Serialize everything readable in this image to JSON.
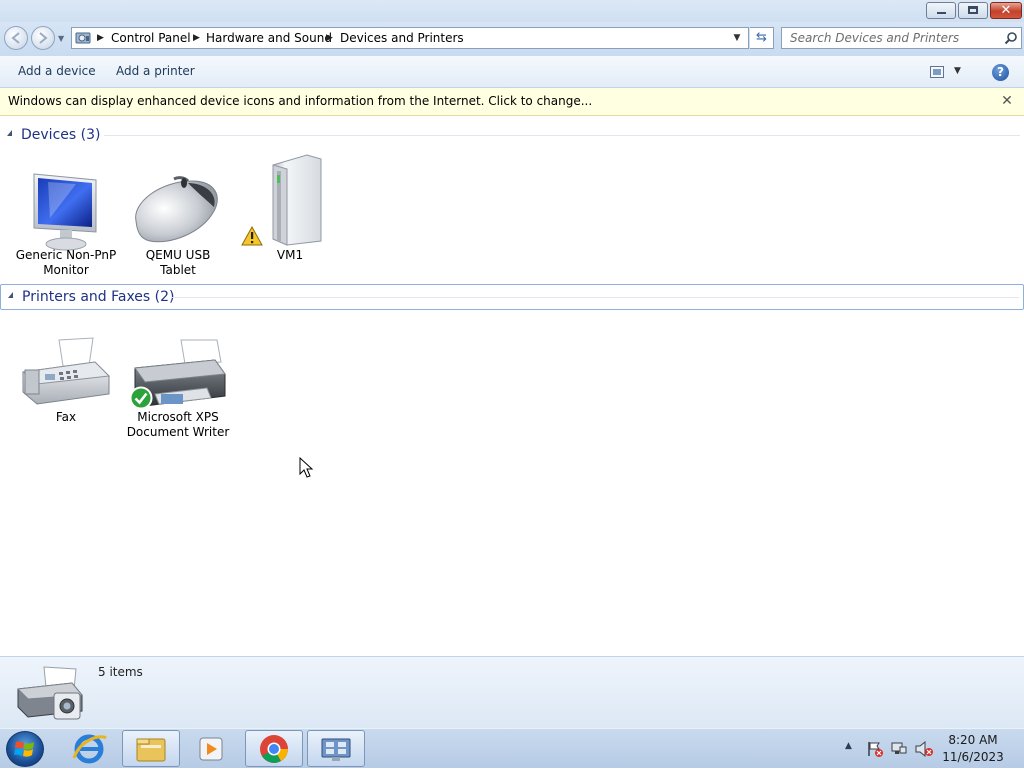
{
  "window": {
    "minimize_icon": "minimize-icon",
    "maximize_icon": "restore-icon",
    "close_icon": "close-icon"
  },
  "address": {
    "crumbs": [
      "Control Panel",
      "Hardware and Sound",
      "Devices and Printers"
    ]
  },
  "search": {
    "placeholder": "Search Devices and Printers"
  },
  "toolbar": {
    "add_device": "Add a device",
    "add_printer": "Add a printer"
  },
  "infobar": {
    "text": "Windows can display enhanced device icons and information from the Internet. Click to change...",
    "close_glyph": "✕"
  },
  "groups": {
    "devices": {
      "title": "Devices (3)",
      "items": [
        {
          "label_line1": "Generic Non-PnP",
          "label_line2": "Monitor",
          "icon": "monitor-icon"
        },
        {
          "label_line1": "QEMU USB",
          "label_line2": "Tablet",
          "icon": "mouse-icon"
        },
        {
          "label_line1": "VM1",
          "label_line2": "",
          "icon": "computer-tower-icon",
          "badge": "warning"
        }
      ]
    },
    "printers": {
      "title": "Printers and Faxes (2)",
      "items": [
        {
          "label_line1": "Fax",
          "label_line2": "",
          "icon": "fax-icon"
        },
        {
          "label_line1": "Microsoft XPS",
          "label_line2": "Document Writer",
          "icon": "printer-icon",
          "badge": "default-check"
        }
      ]
    }
  },
  "details": {
    "count": "5 items"
  },
  "taskbar": {
    "apps": [
      "internet-explorer-icon",
      "file-explorer-icon",
      "media-player-icon",
      "chrome-icon",
      "devices-printers-icon"
    ],
    "time": "8:20 AM",
    "date": "11/6/2023"
  },
  "colors": {
    "accent": "#1e3287",
    "infobar_bg": "#ffffe1",
    "close_red": "#c3422c"
  }
}
